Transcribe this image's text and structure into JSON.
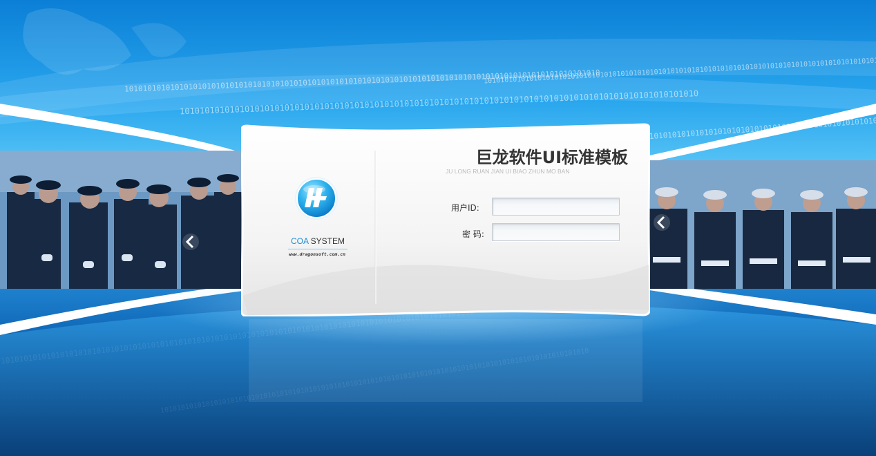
{
  "login": {
    "title": "巨龙软件UI标准模板",
    "subtitle": "JU LONG RUAN JIAN UI BIAO ZHUN MO BAN",
    "user_label": "用户ID:",
    "password_label": "密 码:",
    "user_value": "",
    "password_value": ""
  },
  "brand": {
    "name_accent": "COA",
    "name_rest": " SYSTEM",
    "url": "www.dragonsoft.com.cn"
  },
  "background": {
    "binary_pattern": "10101010101010101010101010101010101010101010101010101010101010101010101010101010101010101010101010101010"
  },
  "colors": {
    "accent": "#1a8fd6",
    "background_top": "#0b7fd6",
    "background_bottom": "#08427f",
    "card": "#f7f7f7"
  },
  "icons": {
    "logo": "dragonsoft-logo-icon",
    "left_arrow": "arrow-left-icon",
    "right_arrow": "arrow-left-icon"
  }
}
